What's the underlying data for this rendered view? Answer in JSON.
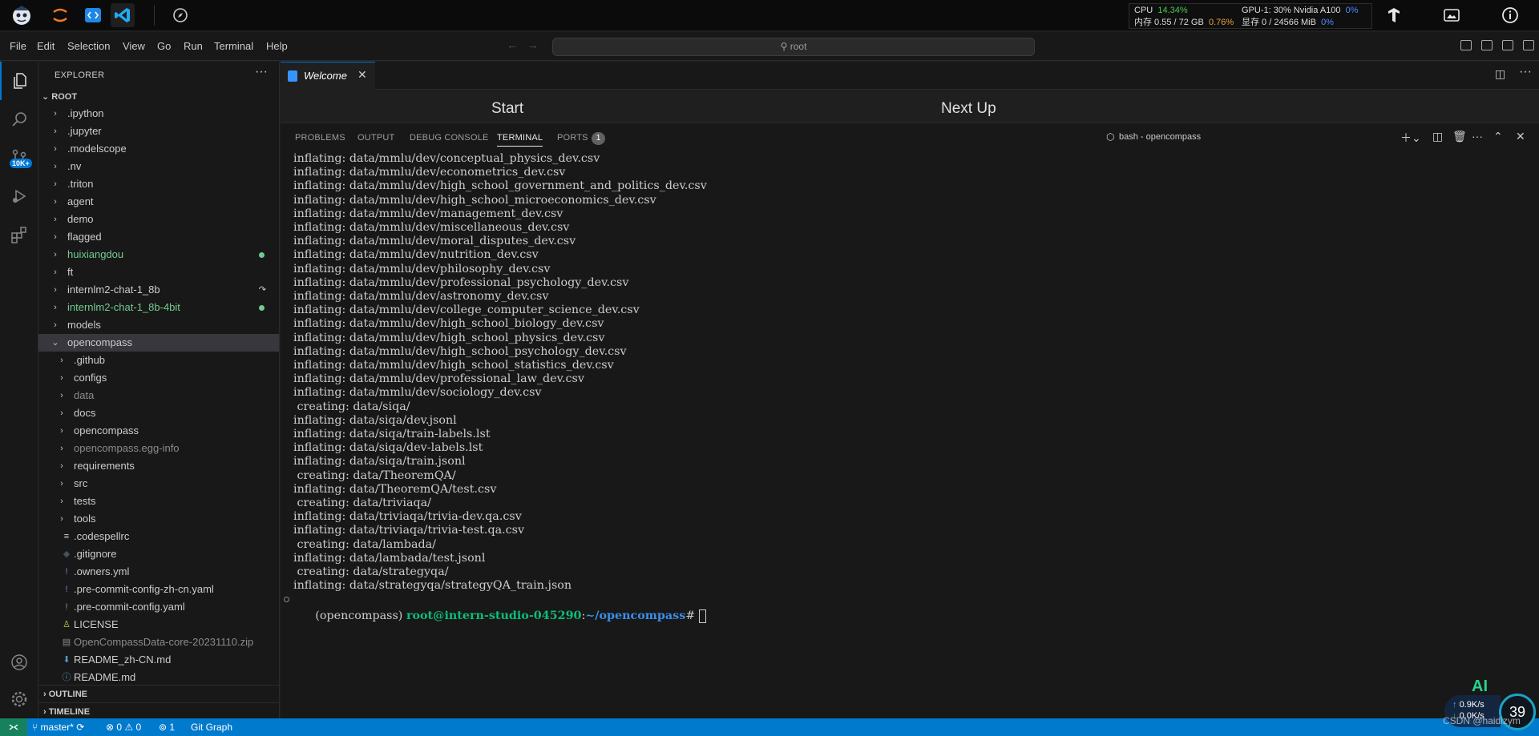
{
  "host": {
    "sysmon": {
      "cpu_label": "CPU",
      "cpu_value": "14.34%",
      "mem_label": "内存 0.55 / 72 GB",
      "mem_value": "0.76%",
      "gpu_label": "GPU-1: 30% Nvidia A100",
      "gpu_value": "0%",
      "vram_label": "显存 0 / 24566 MiB",
      "vram_value": "0%"
    }
  },
  "menubar": {
    "items": [
      "File",
      "Edit",
      "Selection",
      "View",
      "Go",
      "Run",
      "Terminal",
      "Help"
    ],
    "search_text": "root"
  },
  "activity": {
    "badge": "10K+"
  },
  "explorer": {
    "title": "EXPLORER",
    "root_label": "ROOT",
    "items": [
      {
        "label": ".ipython",
        "type": "folder",
        "depth": 0
      },
      {
        "label": ".jupyter",
        "type": "folder",
        "depth": 0
      },
      {
        "label": ".modelscope",
        "type": "folder",
        "depth": 0
      },
      {
        "label": ".nv",
        "type": "folder",
        "depth": 0
      },
      {
        "label": ".triton",
        "type": "folder",
        "depth": 0
      },
      {
        "label": "agent",
        "type": "folder",
        "depth": 0
      },
      {
        "label": "demo",
        "type": "folder",
        "depth": 0
      },
      {
        "label": "flagged",
        "type": "folder",
        "depth": 0
      },
      {
        "label": "huixiangdou",
        "type": "folder",
        "depth": 0,
        "state": "green"
      },
      {
        "label": "ft",
        "type": "folder",
        "depth": 0
      },
      {
        "label": "internlm2-chat-1_8b",
        "type": "folder",
        "depth": 0,
        "state": "link"
      },
      {
        "label": "internlm2-chat-1_8b-4bit",
        "type": "folder",
        "depth": 0,
        "state": "green"
      },
      {
        "label": "models",
        "type": "folder",
        "depth": 0
      },
      {
        "label": "opencompass",
        "type": "folder-open",
        "depth": 0,
        "selected": true
      },
      {
        "label": ".github",
        "type": "folder",
        "depth": 1
      },
      {
        "label": "configs",
        "type": "folder",
        "depth": 1
      },
      {
        "label": "data",
        "type": "folder",
        "depth": 1,
        "state": "dim"
      },
      {
        "label": "docs",
        "type": "folder",
        "depth": 1
      },
      {
        "label": "opencompass",
        "type": "folder",
        "depth": 1
      },
      {
        "label": "opencompass.egg-info",
        "type": "folder",
        "depth": 1,
        "state": "dim"
      },
      {
        "label": "requirements",
        "type": "folder",
        "depth": 1
      },
      {
        "label": "src",
        "type": "folder",
        "depth": 1
      },
      {
        "label": "tests",
        "type": "folder",
        "depth": 1
      },
      {
        "label": "tools",
        "type": "folder",
        "depth": 1
      },
      {
        "label": ".codespellrc",
        "type": "file",
        "icon": "≡",
        "iconColor": "#cccccc",
        "depth": 1
      },
      {
        "label": ".gitignore",
        "type": "file",
        "icon": "◆",
        "iconColor": "#41535b",
        "depth": 1
      },
      {
        "label": ".owners.yml",
        "type": "file",
        "icon": "!",
        "iconColor": "#a074c4",
        "depth": 1
      },
      {
        "label": ".pre-commit-config-zh-cn.yaml",
        "type": "file",
        "icon": "!",
        "iconColor": "#a074c4",
        "depth": 1
      },
      {
        "label": ".pre-commit-config.yaml",
        "type": "file",
        "icon": "!",
        "iconColor": "#a074c4",
        "depth": 1
      },
      {
        "label": "LICENSE",
        "type": "file",
        "icon": "♙",
        "iconColor": "#cbcb41",
        "depth": 1
      },
      {
        "label": "OpenCompassData-core-20231110.zip",
        "type": "file",
        "icon": "▤",
        "iconColor": "#8b8b8b",
        "depth": 1,
        "state": "dim"
      },
      {
        "label": "README_zh-CN.md",
        "type": "file",
        "icon": "⬇",
        "iconColor": "#519aba",
        "depth": 1
      },
      {
        "label": "README.md",
        "type": "file",
        "icon": "ⓘ",
        "iconColor": "#519aba",
        "depth": 1
      }
    ],
    "outline_label": "OUTLINE",
    "timeline_label": "TIMELINE"
  },
  "editor": {
    "tab_label": "Welcome",
    "welcome_start": "Start",
    "welcome_next": "Next Up"
  },
  "panel": {
    "tabs": [
      "PROBLEMS",
      "OUTPUT",
      "DEBUG CONSOLE",
      "TERMINAL",
      "PORTS"
    ],
    "active_tab": "TERMINAL",
    "ports_count": "1",
    "terminal_name": "bash - opencompass"
  },
  "terminal": {
    "lines": [
      "inflating: data/mmlu/dev/conceptual_physics_dev.csv",
      "inflating: data/mmlu/dev/econometrics_dev.csv",
      "inflating: data/mmlu/dev/high_school_government_and_politics_dev.csv",
      "inflating: data/mmlu/dev/high_school_microeconomics_dev.csv",
      "inflating: data/mmlu/dev/management_dev.csv",
      "inflating: data/mmlu/dev/miscellaneous_dev.csv",
      "inflating: data/mmlu/dev/moral_disputes_dev.csv",
      "inflating: data/mmlu/dev/nutrition_dev.csv",
      "inflating: data/mmlu/dev/philosophy_dev.csv",
      "inflating: data/mmlu/dev/professional_psychology_dev.csv",
      "inflating: data/mmlu/dev/astronomy_dev.csv",
      "inflating: data/mmlu/dev/college_computer_science_dev.csv",
      "inflating: data/mmlu/dev/high_school_biology_dev.csv",
      "inflating: data/mmlu/dev/high_school_physics_dev.csv",
      "inflating: data/mmlu/dev/high_school_psychology_dev.csv",
      "inflating: data/mmlu/dev/high_school_statistics_dev.csv",
      "inflating: data/mmlu/dev/professional_law_dev.csv",
      "inflating: data/mmlu/dev/sociology_dev.csv",
      " creating: data/siqa/",
      "inflating: data/siqa/dev.jsonl",
      "inflating: data/siqa/train-labels.lst",
      "inflating: data/siqa/dev-labels.lst",
      "inflating: data/siqa/train.jsonl",
      " creating: data/TheoremQA/",
      "inflating: data/TheoremQA/test.csv",
      " creating: data/triviaqa/",
      "inflating: data/triviaqa/trivia-dev.qa.csv",
      "inflating: data/triviaqa/trivia-test.qa.csv",
      " creating: data/lambada/",
      "inflating: data/lambada/test.jsonl",
      " creating: data/strategyqa/",
      "inflating: data/strategyqa/strategyQA_train.json"
    ],
    "prompt_env": "(opencompass)",
    "prompt_user": "root@intern-studio-045290",
    "prompt_path": "~/opencompass",
    "prompt_symbol": "#"
  },
  "statusbar": {
    "branch": "master*",
    "errors": "0",
    "warnings": "0",
    "ports": "1",
    "git_graph": "Git Graph"
  },
  "overlay": {
    "up_speed": "0.9",
    "up_unit": "K/s",
    "down_speed": "0.0",
    "down_unit": "K/s",
    "gauge": "39",
    "ai_label": "AI",
    "watermark": "CSDN @haidizym"
  }
}
